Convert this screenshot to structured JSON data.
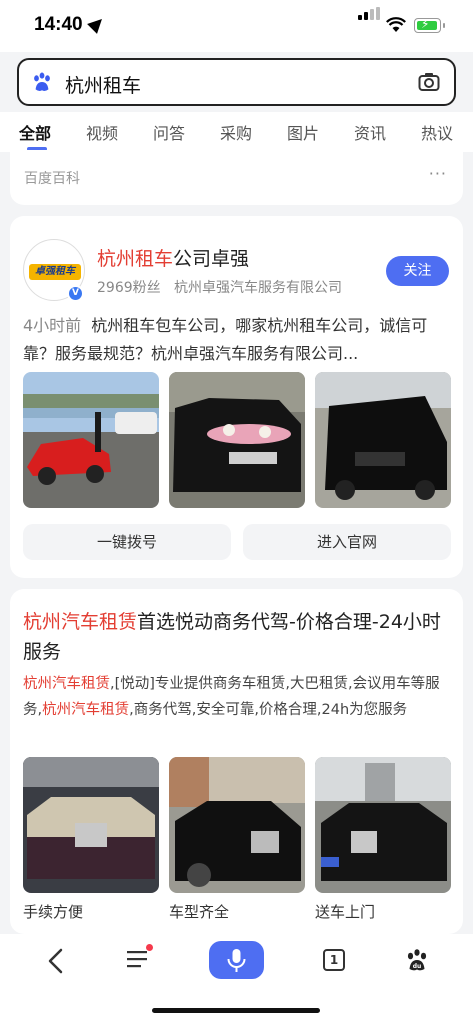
{
  "status": {
    "time": "14:40"
  },
  "search": {
    "query": "杭州租车"
  },
  "tabs": [
    "全部",
    "视频",
    "问答",
    "采购",
    "图片",
    "资讯",
    "热议"
  ],
  "baike": {
    "label": "百度百科",
    "more": "···"
  },
  "account_card": {
    "title_highlight": "杭州租车",
    "title_rest": "公司卓强",
    "fans": "2969粉丝",
    "company": "杭州卓强汽车服务有限公司",
    "follow_label": "关注",
    "time_ago": "4小时前",
    "description": "杭州租车包车公司，哪家杭州租车公司，诚信可靠？服务最规范？杭州卓强汽车服务有限公司...",
    "logo_text": "卓强租车",
    "btn_call": "一键拨号",
    "btn_site": "进入官网"
  },
  "ad_card": {
    "title_highlight": "杭州汽车租赁",
    "title_rest": "首选悦动商务代驾-价格合理-24小时服务",
    "desc_1_red": "杭州汽车租赁",
    "desc_1": ",[悦动]专业提供商务车租赁,大巴租赁,会议用车等服务,",
    "desc_2_red": "杭州汽车租赁",
    "desc_2": ",商务代驾,安全可靠,价格合理,24h为您服务",
    "captions": [
      "手续方便",
      "车型齐全",
      "送车上门"
    ]
  },
  "bottom": {
    "tab_count": "1"
  }
}
